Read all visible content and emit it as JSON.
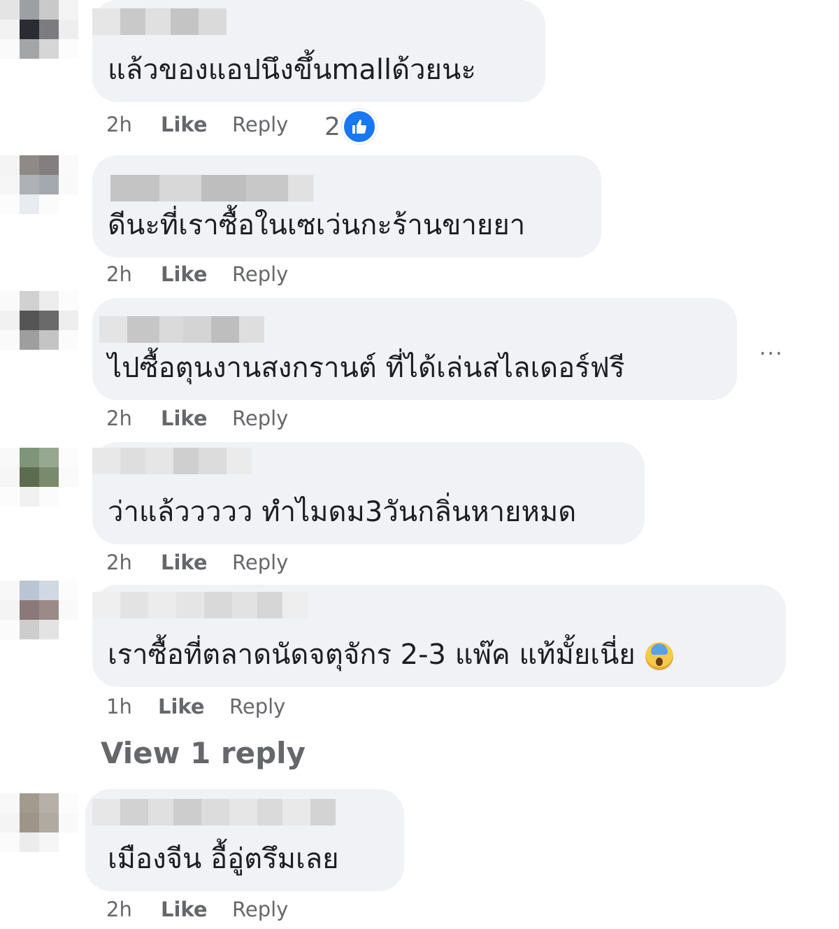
{
  "comments": [
    {
      "text": "แล้วของแอปนึงขึ้นmallด้วยนะ",
      "time": "2h",
      "like_label": "Like",
      "reply_label": "Reply",
      "reactions": "2"
    },
    {
      "text": "ดีนะที่เราซื้อในเซเว่นกะร้านขายยา",
      "time": "2h",
      "like_label": "Like",
      "reply_label": "Reply"
    },
    {
      "text": "ไปซื้อตุนงานสงกรานต์ ที่ได้เล่นสไลเดอร์ฟรี",
      "time": "2h",
      "like_label": "Like",
      "reply_label": "Reply"
    },
    {
      "text": "ว่าแล้ววววว ทำไมดม3วันกลิ่นหายหมด",
      "time": "2h",
      "like_label": "Like",
      "reply_label": "Reply"
    },
    {
      "text": "เราซื้อที่ตลาดนัดจตุจักร 2-3 แพ๊ค แท้มั้ยเนี่ย",
      "time": "1h",
      "like_label": "Like",
      "reply_label": "Reply",
      "emoji": "face-screaming-in-fear-icon"
    },
    {
      "text": "เมืองจีน อื้อู่ตรึมเลย",
      "time": "2h",
      "like_label": "Like",
      "reply_label": "Reply"
    }
  ],
  "view_replies_label": "View 1 reply",
  "more_options_label": "...",
  "colors": {
    "bubble": "#f0f2f5",
    "meta_text": "#65676b",
    "like_blue": "#1877f2"
  }
}
